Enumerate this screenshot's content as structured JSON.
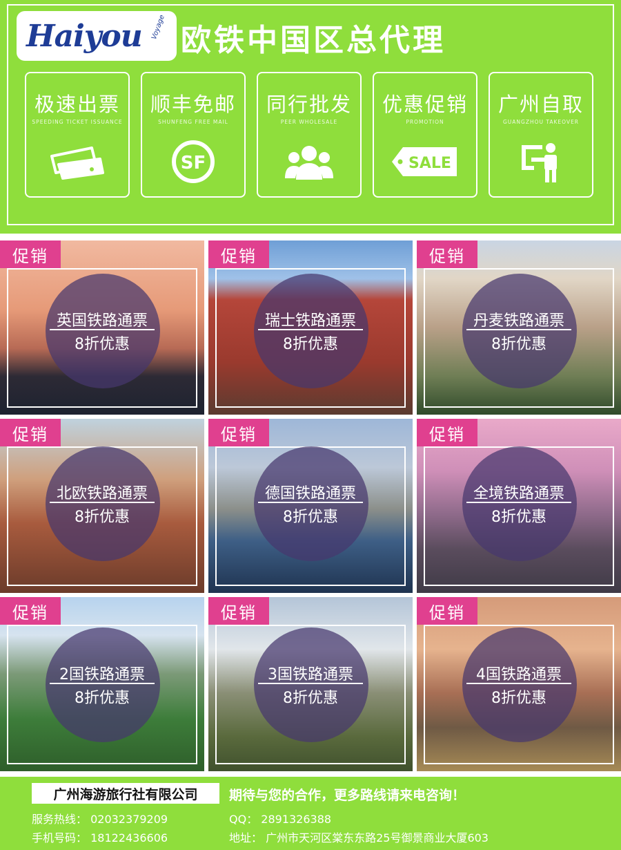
{
  "header": {
    "logo_text": "Haiyou",
    "logo_sub": "Voyage",
    "headline": "欧铁中国区总代理"
  },
  "features": [
    {
      "title": "极速出票",
      "subtitle": "SPEEDING TICKET ISSUANCE",
      "icon": "ticket-icon"
    },
    {
      "title": "顺丰免邮",
      "subtitle": "SHUNFENG FREE MAIL",
      "icon": "sf-express-icon"
    },
    {
      "title": "同行批发",
      "subtitle": "PEER WHOLESALE",
      "icon": "group-icon"
    },
    {
      "title": "优惠促销",
      "subtitle": "PROMOTION",
      "icon": "sale-tag-icon"
    },
    {
      "title": "广州自取",
      "subtitle": "GUANGZHOU TAKEOVER",
      "icon": "self-pickup-icon"
    }
  ],
  "sale_icon_text": "SALE",
  "tiles": [
    {
      "tag": "促销",
      "name": "英国铁路通票",
      "discount": "8折优惠",
      "scene": "tower-bridge-sunset"
    },
    {
      "tag": "促销",
      "name": "瑞士铁路通票",
      "discount": "8折优惠",
      "scene": "red-brick-museum"
    },
    {
      "tag": "促销",
      "name": "丹麦铁路通票",
      "discount": "8折优惠",
      "scene": "paris-rooftops"
    },
    {
      "tag": "促销",
      "name": "北欧铁路通票",
      "discount": "8折优惠",
      "scene": "old-town-rooftops"
    },
    {
      "tag": "促销",
      "name": "德国铁路通票",
      "discount": "8折优惠",
      "scene": "zurich-river"
    },
    {
      "tag": "促销",
      "name": "全境铁路通票",
      "discount": "8折优惠",
      "scene": "eiffel-tower-dusk"
    },
    {
      "tag": "促销",
      "name": "2国铁路通票",
      "discount": "8折优惠",
      "scene": "alpine-village"
    },
    {
      "tag": "促销",
      "name": "3国铁路通票",
      "discount": "8折优惠",
      "scene": "bern-cathedral"
    },
    {
      "tag": "促销",
      "name": "4国铁路通票",
      "discount": "8折优惠",
      "scene": "budapest-parliament"
    }
  ],
  "footer": {
    "company": "广州海游旅行社有限公司",
    "slogan": "期待与您的合作，更多路线请来电咨询！",
    "hotline": "服务热线：  02032379209",
    "mobile": "手机号码：  18122436606",
    "qq": "QQ：  2891326388",
    "address": "地址：  广州市天河区棠东东路25号御景商业大厦603"
  },
  "colors": {
    "brand_green": "#8fde3c",
    "tag_pink": "#e0408f",
    "logo_blue": "#1e3c96",
    "circle_purple": "#46376e"
  }
}
